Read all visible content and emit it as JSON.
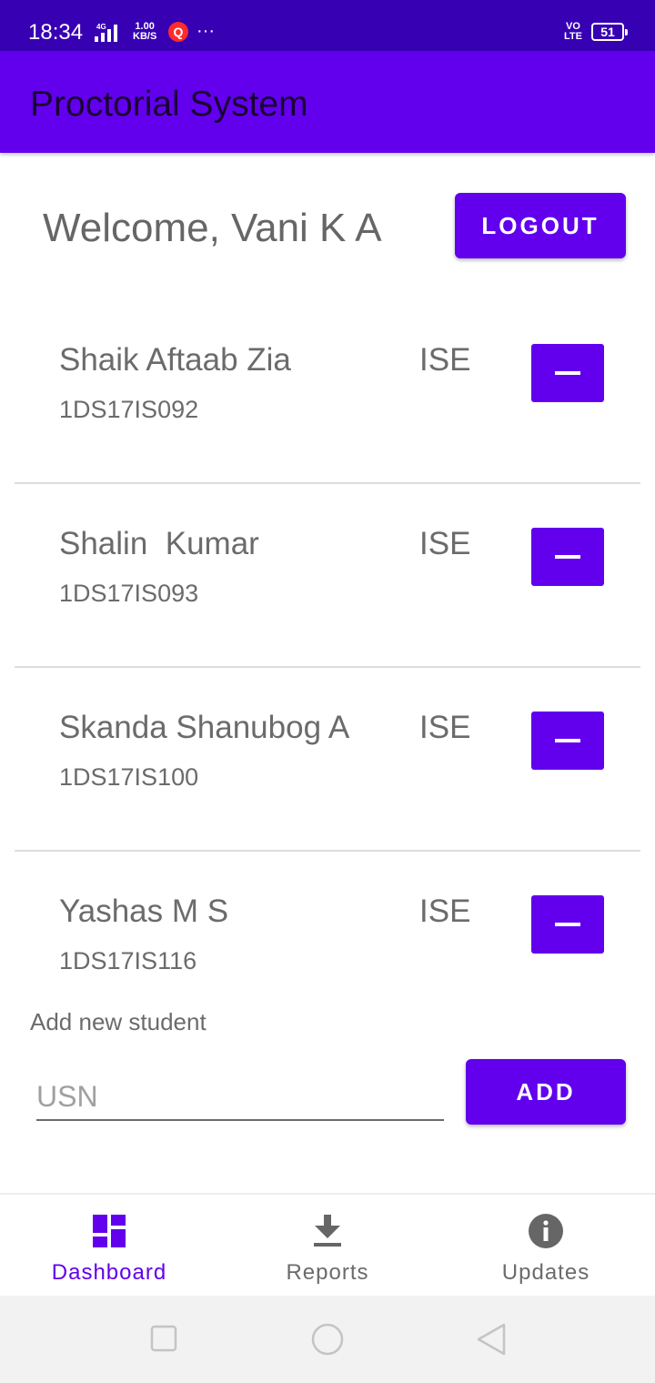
{
  "status_bar": {
    "time": "18:34",
    "network_speed_value": "1.00",
    "network_speed_unit": "KB/S",
    "network_type": "4G",
    "app_badge": "Q",
    "more": "···",
    "volte_top": "VO",
    "volte_bottom": "LTE",
    "battery": "51"
  },
  "app_bar": {
    "title": "Proctorial System"
  },
  "header": {
    "welcome": "Welcome, Vani K A",
    "logout_label": "LOGOUT"
  },
  "students": [
    {
      "name": "Shaik Aftaab Zia",
      "usn": "1DS17IS092",
      "dept": "ISE"
    },
    {
      "name": "Shalin  Kumar",
      "usn": "1DS17IS093",
      "dept": "ISE"
    },
    {
      "name": "Skanda Shanubog A",
      "usn": "1DS17IS100",
      "dept": "ISE"
    },
    {
      "name": "Yashas M S",
      "usn": "1DS17IS116",
      "dept": "ISE"
    }
  ],
  "add_student": {
    "label": "Add new student",
    "placeholder": "USN",
    "value": "",
    "button_label": "ADD"
  },
  "bottom_nav": {
    "items": [
      {
        "label": "Dashboard",
        "icon": "dashboard-icon",
        "active": true
      },
      {
        "label": "Reports",
        "icon": "download-icon",
        "active": false
      },
      {
        "label": "Updates",
        "icon": "info-icon",
        "active": false
      }
    ]
  },
  "colors": {
    "primary": "#6200ee",
    "primary_dark": "#3700b3",
    "text": "#6b6b6b"
  }
}
